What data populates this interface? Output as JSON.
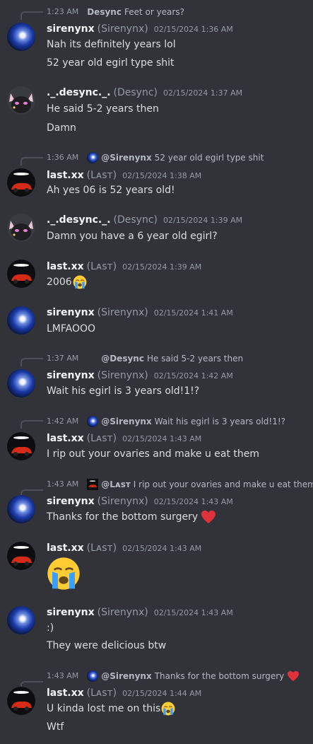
{
  "colors": {
    "background": "#313338",
    "username": "#f2f3f5",
    "muted": "#949ba4",
    "text": "#dbdee1",
    "heart": "#e0323b",
    "sob_face": "#ffcc33",
    "tear": "#3aa0ff"
  },
  "icons": [
    "sirenynx-avatar",
    "desync-avatar",
    "last-avatar",
    "sob-emoji",
    "heart-emoji"
  ],
  "users": {
    "siren": {
      "name": "sirenynx",
      "display": "(Sirenynx)"
    },
    "desync": {
      "name": "._.desync._.",
      "display": "(Desync)"
    },
    "last": {
      "name": "last.xx",
      "display": "(Lᴀsᴛ)"
    }
  },
  "messages": {
    "m1": {
      "reply": {
        "time": "1:23 AM",
        "name": "Desync",
        "text": "Feet or years?"
      },
      "timestamp": "02/15/2024 1:36 AM",
      "lines": [
        "Nah its definitely years lol",
        "52 year old egirl type shit"
      ]
    },
    "m2": {
      "timestamp": "02/15/2024 1:37 AM",
      "lines": [
        "He said 5-2 years then",
        "Damn"
      ]
    },
    "m3": {
      "reply": {
        "time": "1:36 AM",
        "name": "@Sirenynx",
        "text": "52 year old egirl type shit"
      },
      "timestamp": "02/15/2024 1:38 AM",
      "lines": [
        "Ah yes 06 is 52 years old!"
      ]
    },
    "m4": {
      "timestamp": "02/15/2024 1:39 AM",
      "lines": [
        "Damn you have a 6 year old egirl?"
      ]
    },
    "m5": {
      "timestamp": "02/15/2024 1:39 AM",
      "lines": [
        "2006"
      ]
    },
    "m6": {
      "timestamp": "02/15/2024 1:41 AM",
      "lines": [
        "LMFAOOO"
      ]
    },
    "m7": {
      "reply": {
        "time": "1:37 AM",
        "name": "@Desync",
        "text": "He said 5-2 years then"
      },
      "timestamp": "02/15/2024 1:42 AM",
      "lines": [
        "Wait his egirl is 3 years old!1!?"
      ]
    },
    "m8": {
      "reply": {
        "time": "1:42 AM",
        "name": "@Sirenynx",
        "text": "Wait his egirl is 3 years old!1!?"
      },
      "timestamp": "02/15/2024 1:43 AM",
      "lines": [
        "I rip out your ovaries and make u eat them"
      ]
    },
    "m9": {
      "reply": {
        "time": "1:43 AM",
        "name": "@Lᴀsᴛ",
        "text": "I rip out your ovaries and make u eat them"
      },
      "timestamp": "02/15/2024 1:43 AM",
      "lines": [
        "Thanks for the bottom surgery"
      ]
    },
    "m10": {
      "timestamp": "02/15/2024 1:43 AM"
    },
    "m11": {
      "timestamp": "02/15/2024 1:43 AM",
      "lines": [
        ":)",
        "They were delicious btw"
      ]
    },
    "m12": {
      "reply": {
        "time": "1:43 AM",
        "name": "@Sirenynx",
        "text": "Thanks for the bottom surgery"
      },
      "timestamp": "02/15/2024 1:44 AM",
      "lines": [
        "U kinda lost me on this",
        "Wtf"
      ]
    }
  }
}
